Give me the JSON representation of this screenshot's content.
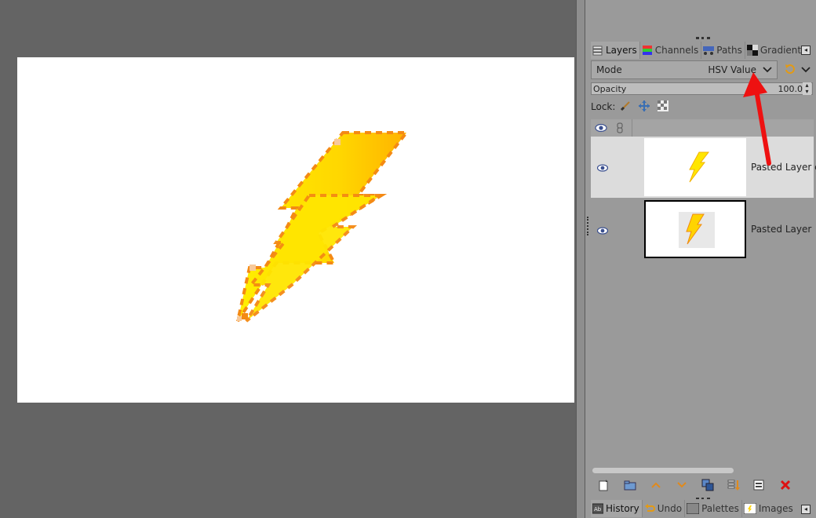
{
  "canvas": {
    "background": "#ffffff"
  },
  "layers_panel": {
    "tabs": [
      {
        "label": "Layers",
        "icon": "layers-icon",
        "active": true
      },
      {
        "label": "Channels",
        "icon": "channels-icon",
        "active": false
      },
      {
        "label": "Paths",
        "icon": "paths-icon",
        "active": false
      },
      {
        "label": "Gradients",
        "icon": "gradients-icon",
        "active": false
      }
    ],
    "mode": {
      "label": "Mode",
      "value": "HSV Value"
    },
    "opacity": {
      "label": "Opacity",
      "value": "100.0"
    },
    "lock": {
      "label": "Lock:"
    },
    "layers": [
      {
        "name": "Pasted Layer c",
        "visible": true,
        "selected": true
      },
      {
        "name": "Pasted Layer",
        "visible": true,
        "selected": false
      }
    ],
    "toolbar": [
      "new-layer-icon",
      "new-layer-group-icon",
      "raise-layer-icon",
      "lower-layer-icon",
      "duplicate-layer-icon",
      "anchor-layer-icon",
      "mask-icon",
      "delete-layer-icon"
    ]
  },
  "bottom_dock": {
    "tabs": [
      {
        "label": "History",
        "icon": "history-icon",
        "active": true
      },
      {
        "label": "Undo",
        "icon": "undo-icon",
        "active": false
      },
      {
        "label": "Palettes",
        "icon": "palettes-icon",
        "active": false
      },
      {
        "label": "Images",
        "icon": "images-icon",
        "active": false
      }
    ]
  },
  "annotation": {
    "color": "#ee1111"
  }
}
